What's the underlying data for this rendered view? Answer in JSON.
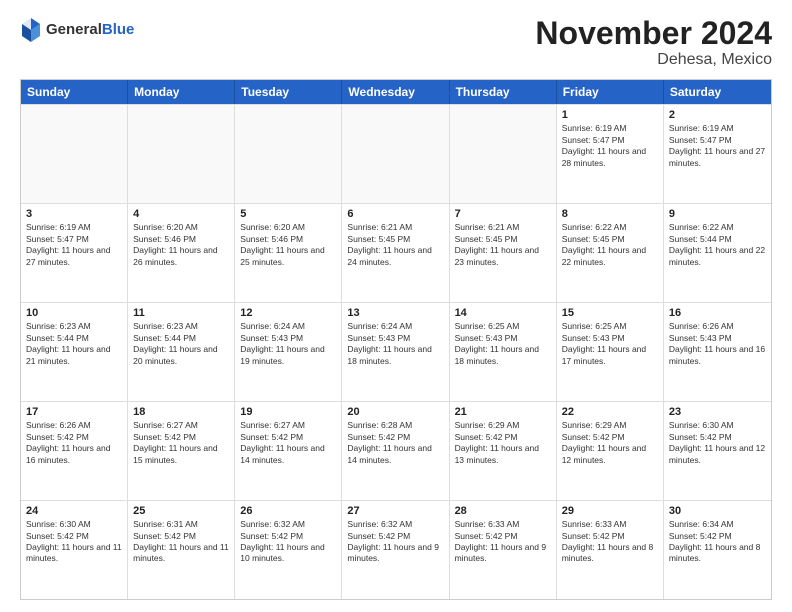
{
  "header": {
    "logo_general": "General",
    "logo_blue": "Blue",
    "month_title": "November 2024",
    "location": "Dehesa, Mexico"
  },
  "calendar": {
    "days_of_week": [
      "Sunday",
      "Monday",
      "Tuesday",
      "Wednesday",
      "Thursday",
      "Friday",
      "Saturday"
    ],
    "weeks": [
      [
        {
          "day": "",
          "empty": true
        },
        {
          "day": "",
          "empty": true
        },
        {
          "day": "",
          "empty": true
        },
        {
          "day": "",
          "empty": true
        },
        {
          "day": "",
          "empty": true
        },
        {
          "day": "1",
          "sunrise": "6:19 AM",
          "sunset": "5:47 PM",
          "daylight": "11 hours and 28 minutes."
        },
        {
          "day": "2",
          "sunrise": "6:19 AM",
          "sunset": "5:47 PM",
          "daylight": "11 hours and 27 minutes."
        }
      ],
      [
        {
          "day": "3",
          "sunrise": "6:19 AM",
          "sunset": "5:47 PM",
          "daylight": "11 hours and 27 minutes."
        },
        {
          "day": "4",
          "sunrise": "6:20 AM",
          "sunset": "5:46 PM",
          "daylight": "11 hours and 26 minutes."
        },
        {
          "day": "5",
          "sunrise": "6:20 AM",
          "sunset": "5:46 PM",
          "daylight": "11 hours and 25 minutes."
        },
        {
          "day": "6",
          "sunrise": "6:21 AM",
          "sunset": "5:45 PM",
          "daylight": "11 hours and 24 minutes."
        },
        {
          "day": "7",
          "sunrise": "6:21 AM",
          "sunset": "5:45 PM",
          "daylight": "11 hours and 23 minutes."
        },
        {
          "day": "8",
          "sunrise": "6:22 AM",
          "sunset": "5:45 PM",
          "daylight": "11 hours and 22 minutes."
        },
        {
          "day": "9",
          "sunrise": "6:22 AM",
          "sunset": "5:44 PM",
          "daylight": "11 hours and 22 minutes."
        }
      ],
      [
        {
          "day": "10",
          "sunrise": "6:23 AM",
          "sunset": "5:44 PM",
          "daylight": "11 hours and 21 minutes."
        },
        {
          "day": "11",
          "sunrise": "6:23 AM",
          "sunset": "5:44 PM",
          "daylight": "11 hours and 20 minutes."
        },
        {
          "day": "12",
          "sunrise": "6:24 AM",
          "sunset": "5:43 PM",
          "daylight": "11 hours and 19 minutes."
        },
        {
          "day": "13",
          "sunrise": "6:24 AM",
          "sunset": "5:43 PM",
          "daylight": "11 hours and 18 minutes."
        },
        {
          "day": "14",
          "sunrise": "6:25 AM",
          "sunset": "5:43 PM",
          "daylight": "11 hours and 18 minutes."
        },
        {
          "day": "15",
          "sunrise": "6:25 AM",
          "sunset": "5:43 PM",
          "daylight": "11 hours and 17 minutes."
        },
        {
          "day": "16",
          "sunrise": "6:26 AM",
          "sunset": "5:43 PM",
          "daylight": "11 hours and 16 minutes."
        }
      ],
      [
        {
          "day": "17",
          "sunrise": "6:26 AM",
          "sunset": "5:42 PM",
          "daylight": "11 hours and 16 minutes."
        },
        {
          "day": "18",
          "sunrise": "6:27 AM",
          "sunset": "5:42 PM",
          "daylight": "11 hours and 15 minutes."
        },
        {
          "day": "19",
          "sunrise": "6:27 AM",
          "sunset": "5:42 PM",
          "daylight": "11 hours and 14 minutes."
        },
        {
          "day": "20",
          "sunrise": "6:28 AM",
          "sunset": "5:42 PM",
          "daylight": "11 hours and 14 minutes."
        },
        {
          "day": "21",
          "sunrise": "6:29 AM",
          "sunset": "5:42 PM",
          "daylight": "11 hours and 13 minutes."
        },
        {
          "day": "22",
          "sunrise": "6:29 AM",
          "sunset": "5:42 PM",
          "daylight": "11 hours and 12 minutes."
        },
        {
          "day": "23",
          "sunrise": "6:30 AM",
          "sunset": "5:42 PM",
          "daylight": "11 hours and 12 minutes."
        }
      ],
      [
        {
          "day": "24",
          "sunrise": "6:30 AM",
          "sunset": "5:42 PM",
          "daylight": "11 hours and 11 minutes."
        },
        {
          "day": "25",
          "sunrise": "6:31 AM",
          "sunset": "5:42 PM",
          "daylight": "11 hours and 11 minutes."
        },
        {
          "day": "26",
          "sunrise": "6:32 AM",
          "sunset": "5:42 PM",
          "daylight": "11 hours and 10 minutes."
        },
        {
          "day": "27",
          "sunrise": "6:32 AM",
          "sunset": "5:42 PM",
          "daylight": "11 hours and 9 minutes."
        },
        {
          "day": "28",
          "sunrise": "6:33 AM",
          "sunset": "5:42 PM",
          "daylight": "11 hours and 9 minutes."
        },
        {
          "day": "29",
          "sunrise": "6:33 AM",
          "sunset": "5:42 PM",
          "daylight": "11 hours and 8 minutes."
        },
        {
          "day": "30",
          "sunrise": "6:34 AM",
          "sunset": "5:42 PM",
          "daylight": "11 hours and 8 minutes."
        }
      ]
    ]
  }
}
